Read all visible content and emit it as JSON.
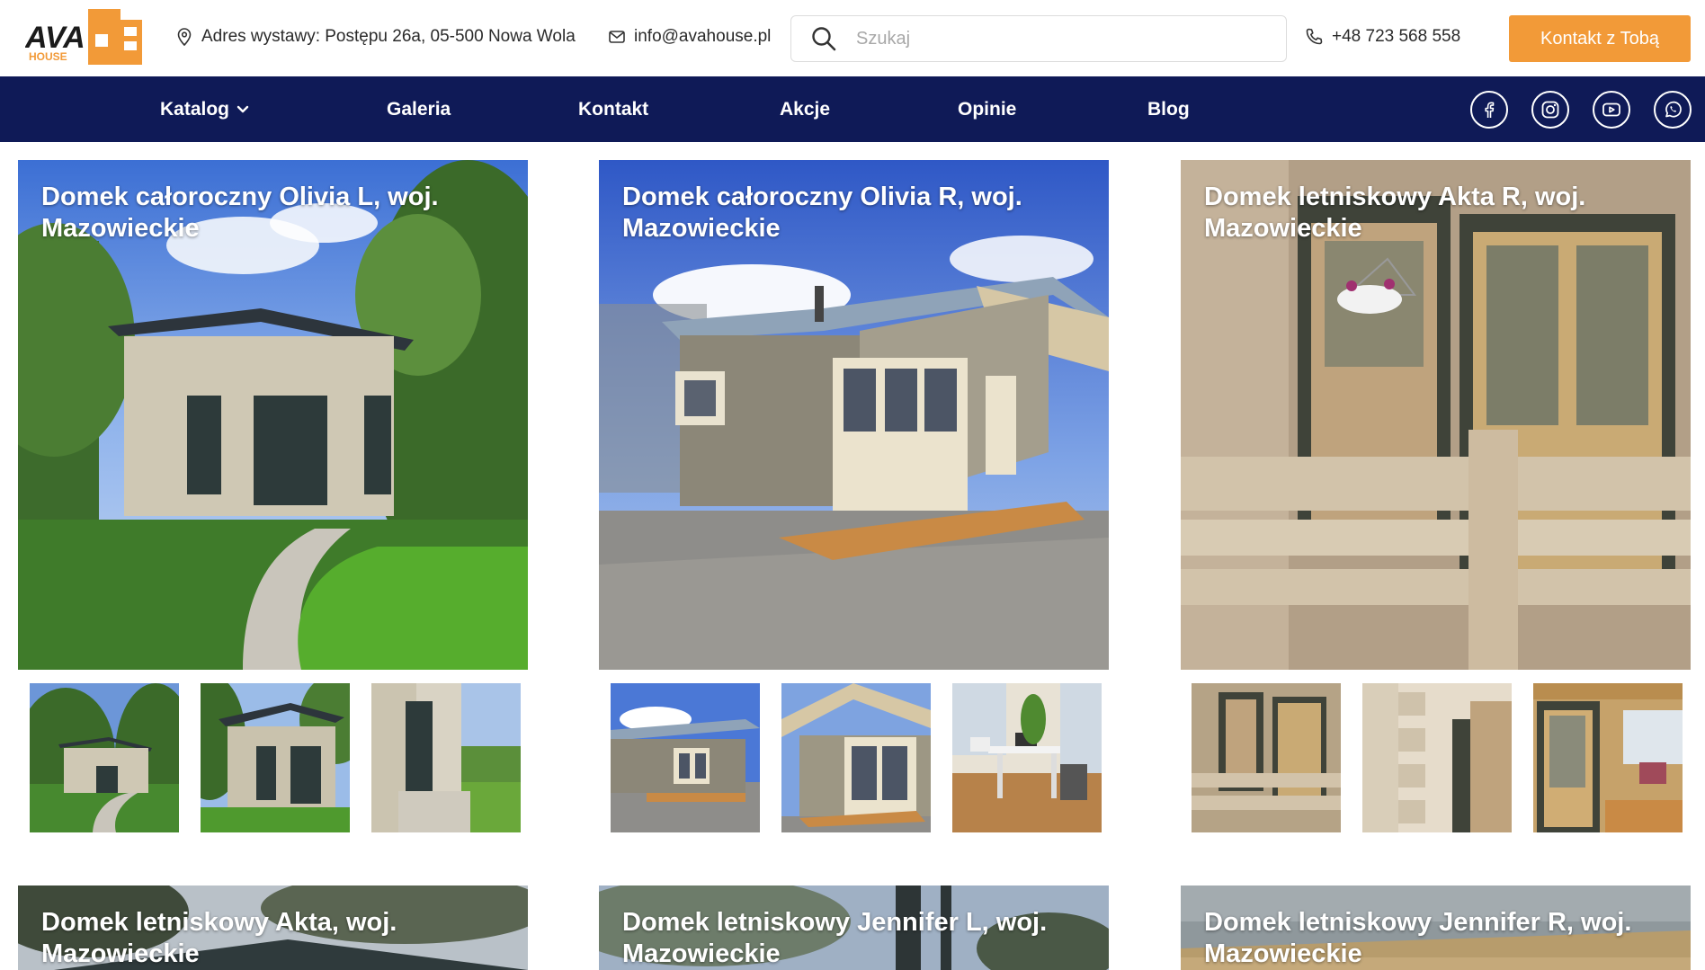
{
  "header": {
    "logo_text": "AVA HOUSE",
    "address": "Adres wystawy: Postępu 26a, 05-500 Nowa Wola",
    "email": "info@avahouse.pl",
    "search_placeholder": "Szukaj",
    "phone": "+48 723 568 558",
    "cta_label": "Kontakt z Tobą"
  },
  "nav": {
    "items": [
      "Katalog",
      "Galeria",
      "Kontakt",
      "Akcje",
      "Opinie",
      "Blog"
    ],
    "social": [
      "facebook-icon",
      "instagram-icon",
      "youtube-icon",
      "whatsapp-icon"
    ]
  },
  "gallery": {
    "cards": [
      {
        "title": "Domek całoroczny Olivia L, woj. Mazowieckie"
      },
      {
        "title": "Domek całoroczny Olivia R, woj. Mazowieckie"
      },
      {
        "title": "Domek letniskowy Akta R, woj. Mazowieckie"
      },
      {
        "title": "Domek letniskowy Akta, woj. Mazowieckie"
      },
      {
        "title": "Domek letniskowy Jennifer L, woj. Mazowieckie"
      },
      {
        "title": "Domek letniskowy Jennifer R, woj. Mazowieckie"
      }
    ]
  },
  "colors": {
    "nav_bg": "#0f1a57",
    "accent": "#f29a38"
  }
}
